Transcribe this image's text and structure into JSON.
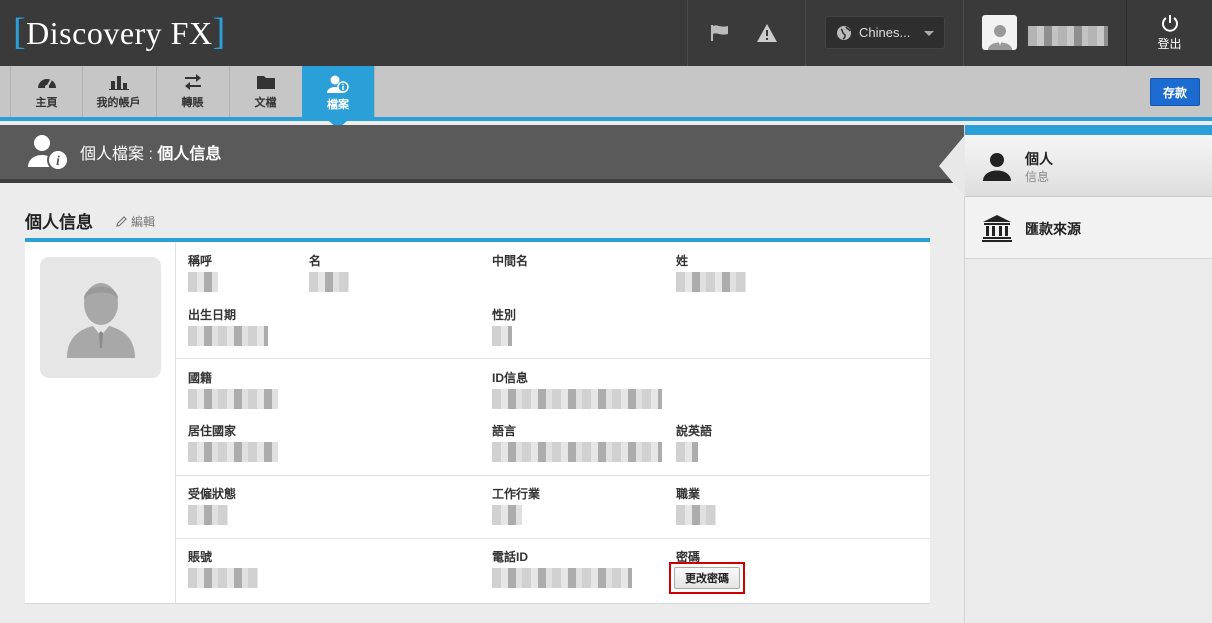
{
  "header": {
    "logo_open": "[",
    "logo_text": "Discovery FX",
    "logo_close": "]",
    "language_selected": "Chines...",
    "logout_label": "登出",
    "icons": [
      "flag-icon",
      "warning-icon",
      "globe-icon",
      "user-icon",
      "power-icon"
    ]
  },
  "nav": {
    "tabs": [
      {
        "label": "主頁",
        "icon": "dashboard-icon"
      },
      {
        "label": "我的帳戶",
        "icon": "bar-chart-icon"
      },
      {
        "label": "轉賬",
        "icon": "transfer-icon"
      },
      {
        "label": "文檔",
        "icon": "folder-icon"
      },
      {
        "label": "檔案",
        "icon": "profile-icon",
        "active": true
      }
    ],
    "deposit_label": "存款"
  },
  "page": {
    "title_prefix": "個人檔案 : ",
    "title_bold": "個人信息"
  },
  "section": {
    "title": "個人信息",
    "edit_label": "編輯"
  },
  "fields": {
    "salutation": "稱呼",
    "first_name": "名",
    "middle_name": "中間名",
    "last_name": "姓",
    "dob": "出生日期",
    "gender": "性別",
    "nationality": "國籍",
    "id_info": "ID信息",
    "country_residence": "居住國家",
    "language": "語言",
    "speaks_english": "說英語",
    "employment_status": "受僱狀態",
    "industry": "工作行業",
    "occupation": "職業",
    "account_no": "賬號",
    "phone_id": "電話ID",
    "password": "密碼",
    "change_password_button": "更改密碼"
  },
  "sidebar": {
    "items": [
      {
        "label": "個人",
        "sub": "信息",
        "icon": "person-icon",
        "active": true
      },
      {
        "label": "匯款來源",
        "icon": "bank-icon"
      }
    ]
  },
  "colors": {
    "accent": "#2a9fd8",
    "header_bg": "#3a3a3a",
    "deposit_button": "#1c6bd0",
    "highlight_box": "#d10000"
  }
}
